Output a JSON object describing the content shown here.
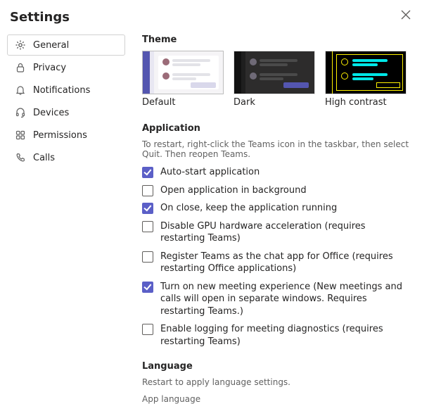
{
  "title": "Settings",
  "sidebar": {
    "items": [
      {
        "label": "General",
        "icon": "gear-icon",
        "active": true
      },
      {
        "label": "Privacy",
        "icon": "lock-icon",
        "active": false
      },
      {
        "label": "Notifications",
        "icon": "bell-icon",
        "active": false
      },
      {
        "label": "Devices",
        "icon": "headset-icon",
        "active": false
      },
      {
        "label": "Permissions",
        "icon": "app-grid-icon",
        "active": false
      },
      {
        "label": "Calls",
        "icon": "phone-icon",
        "active": false
      }
    ]
  },
  "theme": {
    "heading": "Theme",
    "options": [
      {
        "label": "Default",
        "selected": true
      },
      {
        "label": "Dark",
        "selected": false
      },
      {
        "label": "High contrast",
        "selected": false
      }
    ]
  },
  "application": {
    "heading": "Application",
    "helper": "To restart, right-click the Teams icon in the taskbar, then select Quit. Then reopen Teams.",
    "checks": [
      {
        "label": "Auto-start application",
        "checked": true
      },
      {
        "label": "Open application in background",
        "checked": false
      },
      {
        "label": "On close, keep the application running",
        "checked": true
      },
      {
        "label": "Disable GPU hardware acceleration (requires restarting Teams)",
        "checked": false
      },
      {
        "label": "Register Teams as the chat app for Office (requires restarting Office applications)",
        "checked": false
      },
      {
        "label": "Turn on new meeting experience (New meetings and calls will open in separate windows. Requires restarting Teams.)",
        "checked": true
      },
      {
        "label": "Enable logging for meeting diagnostics (requires restarting Teams)",
        "checked": false
      }
    ]
  },
  "language": {
    "heading": "Language",
    "helper": "Restart to apply language settings.",
    "field_label": "App language"
  }
}
